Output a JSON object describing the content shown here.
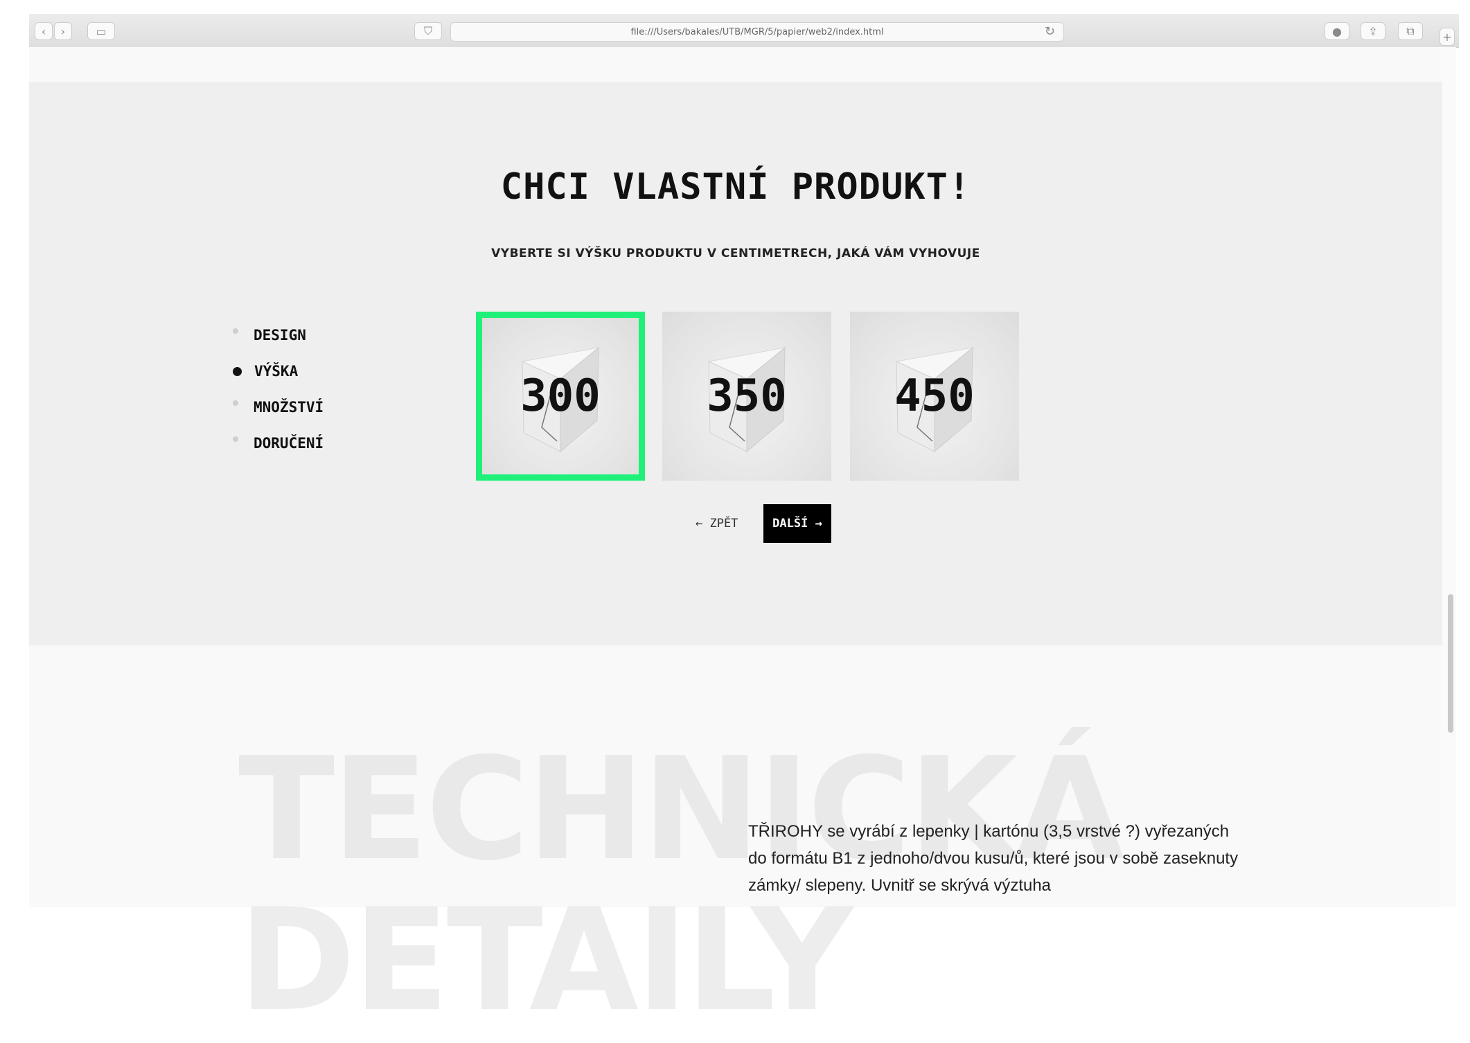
{
  "browser": {
    "url": "file:///Users/bakales/UTB/MGR/5/papier/web2/index.html"
  },
  "hero": {
    "title": "CHCI VLASTNÍ PRODUKT!",
    "subtitle": "VYBERTE SI VÝŠKU PRODUKTU V CENTIMETRECH, JAKÁ VÁM VYHOVUJE"
  },
  "steps": [
    {
      "label": "DESIGN",
      "active": false
    },
    {
      "label": "VÝŠKA",
      "active": true
    },
    {
      "label": "MNOŽSTVÍ",
      "active": false
    },
    {
      "label": "DORUČENÍ",
      "active": false
    }
  ],
  "options": [
    {
      "value": "300",
      "selected": true
    },
    {
      "value": "350",
      "selected": false
    },
    {
      "value": "450",
      "selected": false
    }
  ],
  "nav": {
    "back_label": "← ZPĚT",
    "next_label": "DALŠÍ →"
  },
  "tech": {
    "heading_line1": "TECHNICKÁ",
    "heading_line2": "DETAILY",
    "paragraph": "TŘIROHY se vyrábí z lepenky | kartónu (3,5 vrstvé ?) vyřezaných do formátu B1 z jednoho/dvou kusu/ů, které jsou v sobě zaseknuty zámky/ slepeny. Uvnitř se skrývá výztuha"
  },
  "colors": {
    "selected_border": "#1ef07a",
    "grey_section": "#efefef",
    "next_button_bg": "#000000"
  }
}
